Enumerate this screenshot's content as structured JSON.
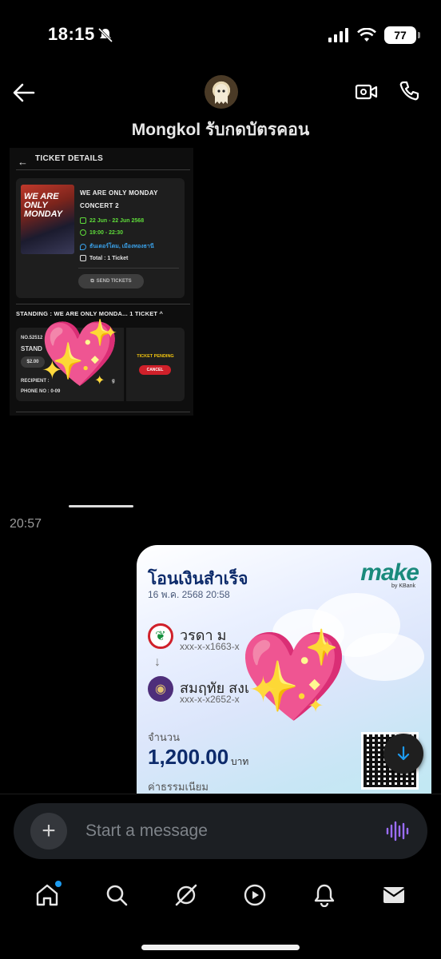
{
  "status_bar": {
    "time": "18:15",
    "battery": "77"
  },
  "header": {
    "contact_name": "Mongkol รับกดบัตรคอน"
  },
  "ticket_screenshot": {
    "title": "TICKET DETAILS",
    "poster_text": "WE ARE ONLY MONDAY",
    "event_name_line1": "WE ARE ONLY MONDAY",
    "event_name_line2": "CONCERT 2",
    "date": "22 Jun - 22 Jun 2568",
    "time": "19:00 - 22:30",
    "venue": "ธันเดอร์โดม, เมืองทองธานี",
    "total": "Total : 1 Ticket",
    "send_label": "SEND TICKETS",
    "standing_header": "STANDING : WE ARE ONLY MONDA... 1 TICKET",
    "ticket_no": "NO.52512",
    "ticket_zone": "STAND",
    "price": "$2.00",
    "recipient": "RECIPIENT :",
    "recipient_tail": "g",
    "phone": "PHONE NO : 0-09",
    "pending": "TICKET PENDING",
    "cancel_label": "CANCEL"
  },
  "message_time": "20:57",
  "slip": {
    "title": "โอนเงินสำเร็จ",
    "date": "16 พ.ค. 2568 20:58",
    "logo": "make",
    "logo_sub": "by KBank",
    "sender_name": "วรดา ม",
    "sender_acct": "xxx-x-x1663-x",
    "receiver_name": "สมฤทัย สงเ",
    "receiver_acct": "xxx-x-x2652-x",
    "amount_label": "จำนวน",
    "amount": "1,200.00",
    "amount_unit": "บาท",
    "fee_label": "ค่าธรรมเนียม"
  },
  "composer": {
    "placeholder": "Start a message"
  },
  "colors": {
    "accent": "#1d9bf0",
    "voice": "#9b6dff"
  }
}
